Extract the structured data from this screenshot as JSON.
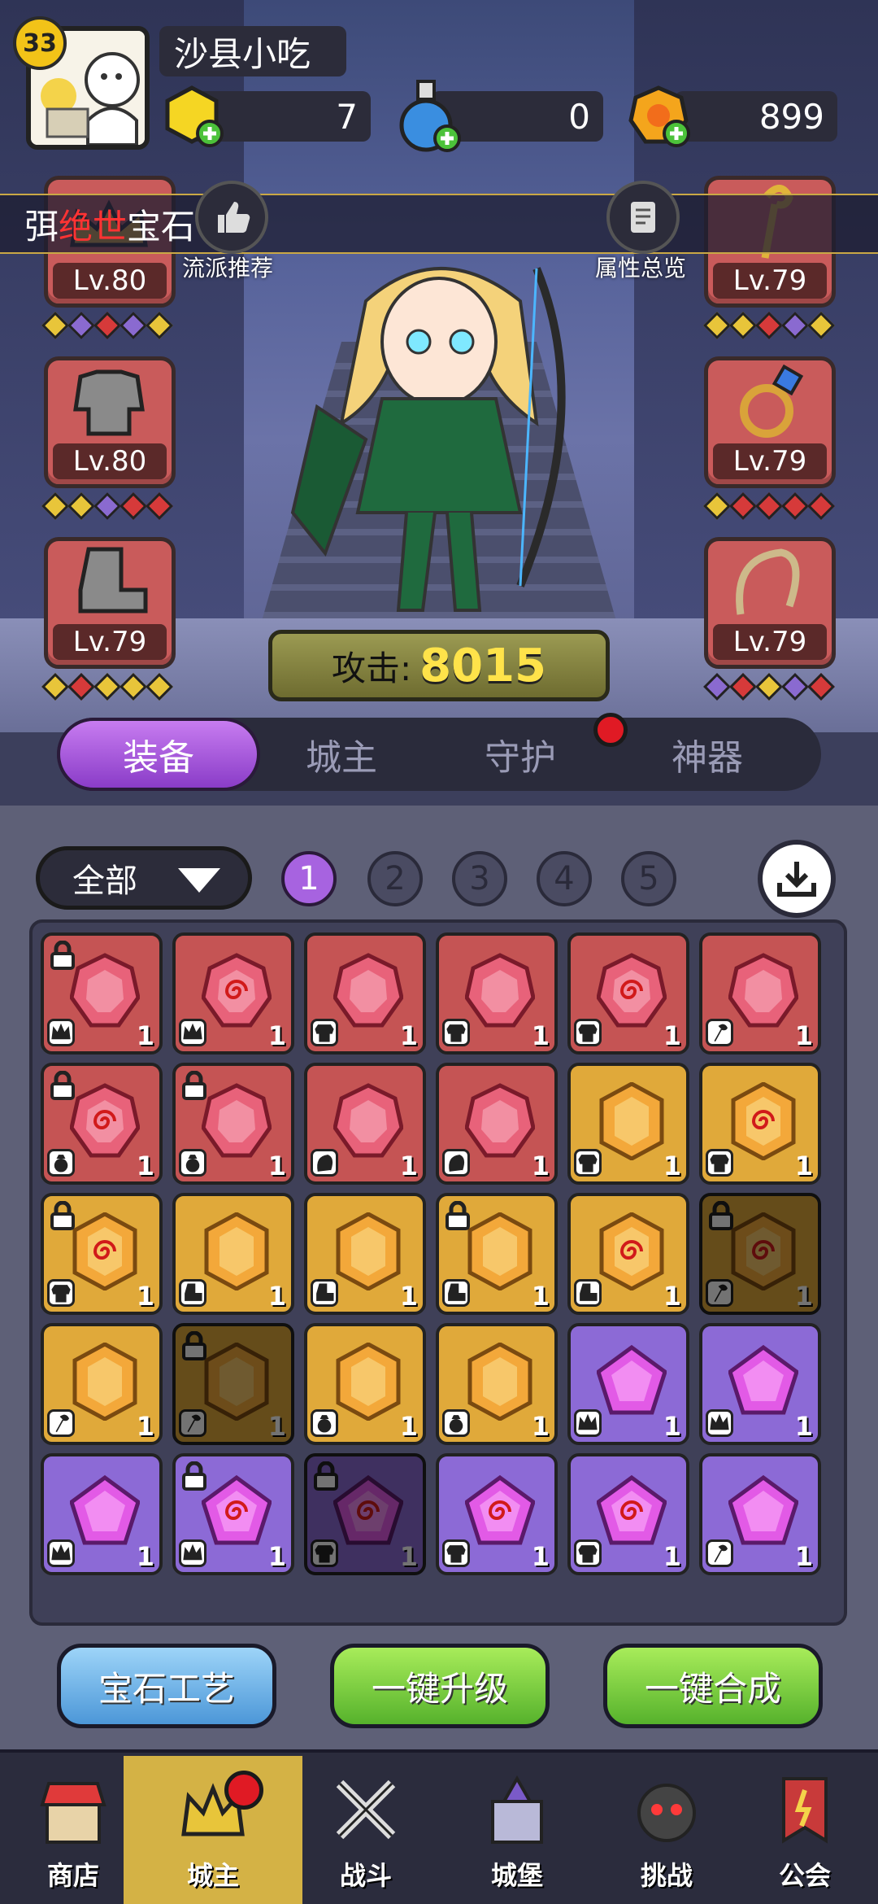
{
  "player": {
    "level": "33",
    "name": "沙县小吃"
  },
  "resources": [
    {
      "name": "gold-crystal",
      "value": "7"
    },
    {
      "name": "potion",
      "value": "0"
    },
    {
      "name": "coin",
      "value": "899"
    }
  ],
  "banner": {
    "prefix": "弭",
    "highlight": "绝世",
    "suffix": "宝石"
  },
  "side_buttons": {
    "left_label": "流派推荐",
    "right_label": "属性总览"
  },
  "equipment": {
    "left": [
      {
        "slot": "crown",
        "level": "Lv.80",
        "gems": [
          "#e8c53a",
          "#8a6ad0",
          "#d63a3a",
          "#8a6ad0",
          "#e8c53a"
        ]
      },
      {
        "slot": "armor",
        "level": "Lv.80",
        "gems": [
          "#e8c53a",
          "#e8c53a",
          "#8a6ad0",
          "#d63a3a",
          "#d63a3a"
        ]
      },
      {
        "slot": "boots",
        "level": "Lv.79",
        "gems": [
          "#e8c53a",
          "#d63a3a",
          "#e8c53a",
          "#e8c53a",
          "#e8c53a"
        ]
      }
    ],
    "right": [
      {
        "slot": "staff",
        "level": "Lv.79",
        "gems": [
          "#e8c53a",
          "#e8c53a",
          "#d63a3a",
          "#8a6ad0",
          "#e8c53a"
        ]
      },
      {
        "slot": "ring",
        "level": "Lv.79",
        "gems": [
          "#e8c53a",
          "#d63a3a",
          "#d63a3a",
          "#d63a3a",
          "#d63a3a"
        ]
      },
      {
        "slot": "whip",
        "level": "Lv.79",
        "gems": [
          "#8a6ad0",
          "#d63a3a",
          "#e8c53a",
          "#8a6ad0",
          "#d63a3a"
        ]
      }
    ]
  },
  "attack": {
    "label": "攻击:",
    "value": "8015"
  },
  "tabs": [
    {
      "label": "装备",
      "active": true
    },
    {
      "label": "城主",
      "active": false
    },
    {
      "label": "守护",
      "active": false
    },
    {
      "label": "神器",
      "active": false
    }
  ],
  "filter": {
    "selected": "全部"
  },
  "pages": [
    "1",
    "2",
    "3",
    "4",
    "5"
  ],
  "active_page": "1",
  "gems": [
    {
      "color": "red",
      "type": "crown",
      "count": "1",
      "locked": true
    },
    {
      "color": "red",
      "type": "crown",
      "count": "1",
      "locked": false,
      "swirl": true
    },
    {
      "color": "red",
      "type": "armor",
      "count": "1",
      "locked": false
    },
    {
      "color": "red",
      "type": "armor",
      "count": "1",
      "locked": false
    },
    {
      "color": "red",
      "type": "armor",
      "count": "1",
      "locked": false,
      "swirl": true
    },
    {
      "color": "red",
      "type": "staff",
      "count": "1",
      "locked": false
    },
    {
      "color": "red",
      "type": "ring",
      "count": "1",
      "locked": true,
      "swirl": true
    },
    {
      "color": "red",
      "type": "ring",
      "count": "1",
      "locked": true
    },
    {
      "color": "red",
      "type": "whip",
      "count": "1",
      "locked": false
    },
    {
      "color": "red",
      "type": "whip",
      "count": "1",
      "locked": false
    },
    {
      "color": "orange",
      "type": "armor",
      "count": "1",
      "locked": false
    },
    {
      "color": "orange",
      "type": "armor",
      "count": "1",
      "locked": false,
      "swirl": true
    },
    {
      "color": "orange",
      "type": "armor",
      "count": "1",
      "locked": true,
      "swirl": true
    },
    {
      "color": "orange",
      "type": "boots",
      "count": "1",
      "locked": false
    },
    {
      "color": "orange",
      "type": "boots",
      "count": "1",
      "locked": false
    },
    {
      "color": "orange",
      "type": "boots",
      "count": "1",
      "locked": true
    },
    {
      "color": "orange",
      "type": "boots",
      "count": "1",
      "locked": false,
      "swirl": true
    },
    {
      "color": "orange",
      "type": "staff",
      "count": "1",
      "locked": true,
      "swirl": true,
      "dim": true
    },
    {
      "color": "orange",
      "type": "staff",
      "count": "1",
      "locked": false
    },
    {
      "color": "orange",
      "type": "staff",
      "count": "1",
      "locked": true,
      "dim": true
    },
    {
      "color": "orange",
      "type": "ring",
      "count": "1",
      "locked": false
    },
    {
      "color": "orange",
      "type": "ring",
      "count": "1",
      "locked": false
    },
    {
      "color": "purple",
      "type": "crown",
      "count": "1",
      "locked": false
    },
    {
      "color": "purple",
      "type": "crown",
      "count": "1",
      "locked": false
    },
    {
      "color": "purple",
      "type": "crown",
      "count": "1",
      "locked": false
    },
    {
      "color": "purple",
      "type": "crown",
      "count": "1",
      "locked": true,
      "swirl": true
    },
    {
      "color": "purple",
      "type": "armor",
      "count": "1",
      "locked": true,
      "swirl": true,
      "dim": true
    },
    {
      "color": "purple",
      "type": "armor",
      "count": "1",
      "locked": false,
      "swirl": true
    },
    {
      "color": "purple",
      "type": "armor",
      "count": "1",
      "locked": false,
      "swirl": true
    },
    {
      "color": "purple",
      "type": "staff",
      "count": "1",
      "locked": false
    }
  ],
  "actions": {
    "craft": "宝石工艺",
    "upgrade": "一键升级",
    "merge": "一键合成"
  },
  "nav": [
    {
      "label": "商店",
      "icon": "shop-icon"
    },
    {
      "label": "城主",
      "icon": "crown-icon",
      "active": true,
      "badge": true
    },
    {
      "label": "战斗",
      "icon": "swords-icon"
    },
    {
      "label": "城堡",
      "icon": "castle-icon"
    },
    {
      "label": "挑战",
      "icon": "demon-icon"
    },
    {
      "label": "公会",
      "icon": "guild-banner-icon"
    }
  ],
  "colors": {
    "red_gem": "#c55454",
    "orange_gem": "#e0a93a",
    "purple_gem": "#8c6ad6",
    "accent_purple": "#a763e0",
    "badge_red": "#e01a24"
  }
}
